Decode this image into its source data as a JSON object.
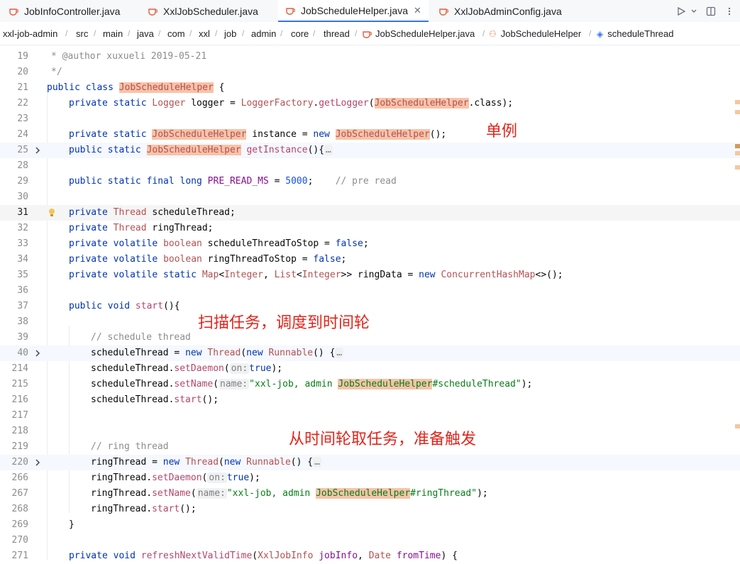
{
  "tabs": [
    {
      "label": "JobInfoController.java",
      "active": false
    },
    {
      "label": "XxlJobScheduler.java",
      "active": false
    },
    {
      "label": "JobScheduleHelper.java",
      "active": true
    },
    {
      "label": "XxlJobAdminConfig.java",
      "active": false
    }
  ],
  "breadcrumb": [
    "xxl-job-admin",
    "src",
    "main",
    "java",
    "com",
    "xxl",
    "job",
    "admin",
    "core",
    "thread",
    "JobScheduleHelper.java",
    "JobScheduleHelper",
    "scheduleThread"
  ],
  "annotations": {
    "singleton": "单例",
    "schedule_thread": "扫描任务，调度到时间轮",
    "ring_thread": "从时间轮取任务，准备触发"
  },
  "line_numbers": [
    "19",
    "20",
    "21",
    "22",
    "23",
    "24",
    "25",
    "28",
    "29",
    "30",
    "31",
    "32",
    "33",
    "34",
    "35",
    "36",
    "37",
    "38",
    "39",
    "40",
    "214",
    "215",
    "216",
    "217",
    "218",
    "219",
    "220",
    "266",
    "267",
    "268",
    "269",
    "270",
    "271"
  ],
  "code": {
    "l19": "* @author xuxueli 2019-05-21",
    "l20": "*/",
    "l21_a": "public class ",
    "l21_b": "JobScheduleHelper",
    "l21_c": " {",
    "l22_a": "private static ",
    "l22_b": "Logger",
    "l22_c": " logger = ",
    "l22_d": "LoggerFactory",
    "l22_e": ".",
    "l22_f": "getLogger",
    "l22_g": "(",
    "l22_h": "JobScheduleHelper",
    "l22_i": ".class);",
    "l24_a": "private static ",
    "l24_b": "JobScheduleHelper",
    "l24_c": " instance = ",
    "l24_d": "new ",
    "l24_e": "JobScheduleHelper",
    "l24_f": "();",
    "l25_a": "public static ",
    "l25_b": "JobScheduleHelper",
    "l25_c": " ",
    "l25_d": "getInstance",
    "l25_e": "(){",
    "l25_f": "…",
    "l29_a": "public static final long ",
    "l29_b": "PRE_READ_MS",
    "l29_c": " = ",
    "l29_d": "5000",
    "l29_e": ";    ",
    "l29_f": "// pre read",
    "l31_a": "private ",
    "l31_b": "Thread",
    "l31_c": " scheduleThread;",
    "l32_a": "private ",
    "l32_b": "Thread",
    "l32_c": " ringThread;",
    "l33_a": "private volatile ",
    "l33_b": "boolean",
    "l33_c": " scheduleThreadToStop = ",
    "l33_d": "false",
    "l33_e": ";",
    "l34_a": "private volatile ",
    "l34_b": "boolean",
    "l34_c": " ringThreadToStop = ",
    "l34_d": "false",
    "l34_e": ";",
    "l35_a": "private volatile static ",
    "l35_b": "Map",
    "l35_c": "<",
    "l35_d": "Integer",
    "l35_e": ", ",
    "l35_f": "List",
    "l35_g": "<",
    "l35_h": "Integer",
    "l35_i": ">> ringData = ",
    "l35_j": "new ",
    "l35_k": "ConcurrentHashMap",
    "l35_l": "<>();",
    "l37_a": "public void ",
    "l37_b": "start",
    "l37_c": "(){",
    "l39": "// schedule thread",
    "l40_a": "scheduleThread = ",
    "l40_b": "new ",
    "l40_c": "Thread",
    "l40_d": "(",
    "l40_e": "new ",
    "l40_f": "Runnable",
    "l40_g": "() {",
    "l40_h": "…",
    "l214_a": "scheduleThread.",
    "l214_b": "setDaemon",
    "l214_c": "(",
    "l214_d": "on:",
    "l214_e": "true",
    "l214_f": ");",
    "l215_a": "scheduleThread.",
    "l215_b": "setName",
    "l215_c": "(",
    "l215_d": "name:",
    "l215_e": "\"xxl-job, admin ",
    "l215_f": "JobScheduleHelper",
    "l215_g": "#scheduleThread\"",
    "l215_h": ");",
    "l216_a": "scheduleThread.",
    "l216_b": "start",
    "l216_c": "();",
    "l219": "// ring thread",
    "l220_a": "ringThread = ",
    "l220_b": "new ",
    "l220_c": "Thread",
    "l220_d": "(",
    "l220_e": "new ",
    "l220_f": "Runnable",
    "l220_g": "() {",
    "l220_h": "…",
    "l266_a": "ringThread.",
    "l266_b": "setDaemon",
    "l266_c": "(",
    "l266_d": "on:",
    "l266_e": "true",
    "l266_f": ");",
    "l267_a": "ringThread.",
    "l267_b": "setName",
    "l267_c": "(",
    "l267_d": "name:",
    "l267_e": "\"xxl-job, admin ",
    "l267_f": "JobScheduleHelper",
    "l267_g": "#ringThread\"",
    "l267_h": ");",
    "l268_a": "ringThread.",
    "l268_b": "start",
    "l268_c": "();",
    "l269": "}",
    "l271_a": "private void ",
    "l271_b": "refreshNextValidTime",
    "l271_c": "(",
    "l271_d": "XxlJobInfo",
    "l271_e": " ",
    "l271_f": "jobInfo",
    "l271_g": ", ",
    "l271_h": "Date",
    "l271_i": " ",
    "l271_j": "fromTime",
    "l271_k": ") {"
  },
  "colors": {
    "accent": "#3574f0",
    "annotation": "#e1251b",
    "keyword": "#0033b3",
    "class_highlight": "#f7c3a8"
  }
}
